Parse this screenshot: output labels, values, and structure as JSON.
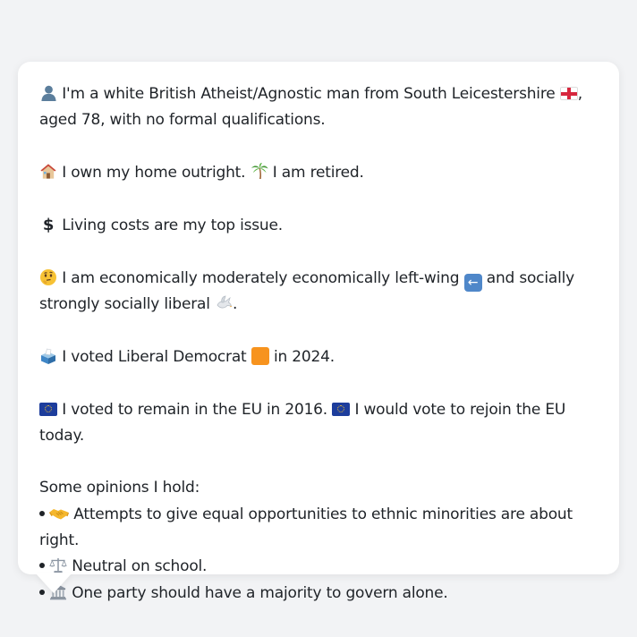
{
  "message": {
    "intro": {
      "icon": "person-silhouette-icon",
      "text_part1": "I'm a white British Atheist/Agnostic man from South Leicestershire",
      "flag": "england-flag-icon",
      "text_part2": ",",
      "line2": "aged 78, with no formal qualifications."
    },
    "home": {
      "icon": "house-icon",
      "text1": "I own my home outright.",
      "icon2": "palm-tree-icon",
      "text2": "I am retired."
    },
    "issue": {
      "icon": "dollar-sign-icon",
      "text": "Living costs are my top issue."
    },
    "ideology": {
      "icon": "thinking-face-icon",
      "text1": "I am economically moderately economically left-wing",
      "icon2": "left-arrow-icon",
      "text2": "and socially",
      "line2": "strongly socially liberal",
      "icon3": "dove-icon",
      "text3": "."
    },
    "vote2024": {
      "icon": "ballot-box-icon",
      "text1": "I voted Liberal Democrat",
      "color": "#f7931e",
      "text2": "in 2024."
    },
    "eu": {
      "icon": "eu-flag-icon",
      "text1": "I voted to remain in the EU in 2016.",
      "text2": "I would vote to rejoin the EU today."
    },
    "opinions": {
      "heading": "Some opinions I hold:",
      "items": [
        {
          "icon": "handshake-icon",
          "text": "Attempts to give equal opportunities to ethnic minorities are about right."
        },
        {
          "icon": "balance-scale-icon",
          "text": "Neutral on school."
        },
        {
          "icon": "classical-building-icon",
          "text": "One party should have a majority to govern alone."
        }
      ]
    }
  }
}
